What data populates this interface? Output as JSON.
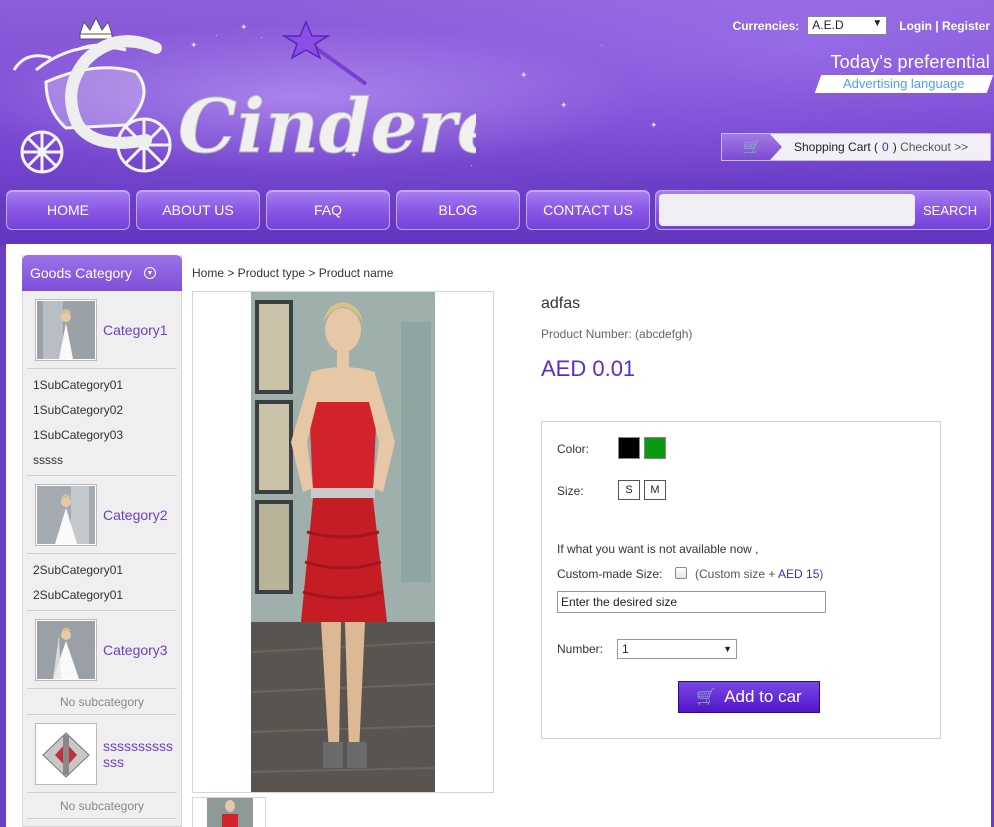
{
  "header": {
    "logo_text": "Cinderella",
    "currencies_label": "Currencies:",
    "currency_value": "A.E.D",
    "login": "Login",
    "separator": "|",
    "register": "Register",
    "promo_title": "Today's preferential",
    "promo_sub": "Advertising language",
    "cart": {
      "label": "Shopping Cart (",
      "count": "0",
      "close": ")",
      "checkout": "Checkout >>"
    }
  },
  "nav": {
    "items": [
      "HOME",
      "ABOUT US",
      "FAQ",
      "BLOG",
      "CONTACT US"
    ],
    "search_button": "SEARCH"
  },
  "sidebar": {
    "title": "Goods Category",
    "categories": [
      {
        "name": "Category1",
        "subs": [
          "1SubCategory01",
          "1SubCategory02",
          "1SubCategory03",
          "sssss"
        ]
      },
      {
        "name": "Category2",
        "subs": [
          "2SubCategory01",
          "2SubCategory01"
        ]
      },
      {
        "name": "Category3",
        "nosub": "No subcategory"
      },
      {
        "name": "sssssssssssss",
        "nosub": "No subcategory"
      }
    ]
  },
  "breadcrumb": "Home > Product type > Product name",
  "product": {
    "name": "adfas",
    "number": "Product Number: (abcdefgh)",
    "price": "AED 0.01",
    "color_label": "Color:",
    "colors": [
      "#000000",
      "#0a9a12"
    ],
    "size_label": "Size:",
    "sizes": [
      "S",
      "M"
    ],
    "unavailable_text": "If what you want is not available now ,",
    "custom_label": "Custom-made Size:",
    "custom_note_prefix": "(Custom size +",
    "custom_note_amount": "AED 15",
    "custom_note_suffix": ")",
    "size_input_value": "Enter the desired size",
    "number_label": "Number:",
    "number_value": "1",
    "add_button": "Add to car"
  }
}
